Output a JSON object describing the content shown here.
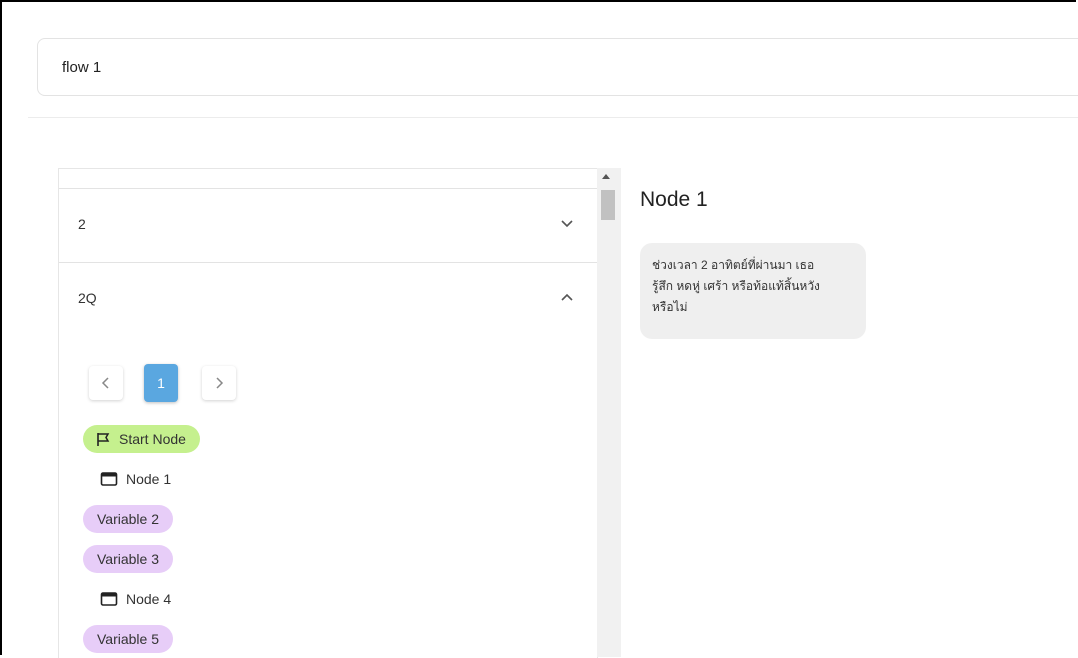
{
  "flow": {
    "title": "flow 1"
  },
  "accordion": {
    "items": [
      {
        "label": "2",
        "expanded": false
      },
      {
        "label": "2Q",
        "expanded": true
      }
    ]
  },
  "pagination": {
    "prev_icon": "chevron-left-icon",
    "current": "1",
    "next_icon": "chevron-right-icon"
  },
  "nodes": [
    {
      "label": "Start Node",
      "kind": "start",
      "icon": "flag-icon",
      "color": "#c5f08e"
    },
    {
      "label": "Node 1",
      "kind": "node",
      "icon": "window-icon"
    },
    {
      "label": "Variable 2",
      "kind": "variable",
      "color": "#e7cdf8"
    },
    {
      "label": "Variable 3",
      "kind": "variable",
      "color": "#e7cdf8"
    },
    {
      "label": "Node 4",
      "kind": "node",
      "icon": "window-icon"
    },
    {
      "label": "Variable 5",
      "kind": "variable",
      "color": "#e7cdf8"
    }
  ],
  "detail": {
    "title": "Node 1",
    "message_lines": [
      "ช่วงเวลา 2 อาทิตย์ที่ผ่านมา เธอ",
      "รู้สึก หดหู่ เศร้า หรือท้อแท้สิ้นหวัง",
      "หรือไม่"
    ]
  },
  "colors": {
    "accent": "#5aa7e0",
    "start": "#c5f08e",
    "variable": "#e7cdf8",
    "bubble": "#efefef"
  }
}
